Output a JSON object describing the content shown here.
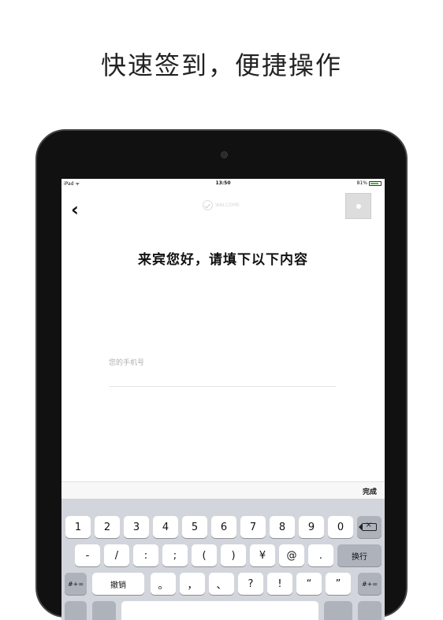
{
  "headline": "快速签到，便捷操作",
  "status_bar": {
    "carrier": "iPad",
    "time": "13:50",
    "battery": "81%",
    "battery_level": 0.81
  },
  "header": {
    "back_label": "‹",
    "logo_text": "WALCOME"
  },
  "form": {
    "title": "来宾您好，请填下以下内容",
    "phone_placeholder": "您的手机号",
    "phone_value": ""
  },
  "accessory": {
    "done_label": "完成"
  },
  "keyboard": {
    "row1": [
      "1",
      "2",
      "3",
      "4",
      "5",
      "6",
      "7",
      "8",
      "9",
      "0"
    ],
    "row2": [
      "-",
      "/",
      ":",
      ";",
      "(",
      ")",
      "¥",
      "@",
      "."
    ],
    "row2_action": "换行",
    "row3_left": "#+=",
    "row3_undo": "撤销",
    "row3": [
      "。",
      "，",
      "、",
      "?",
      "!",
      "“",
      "”"
    ],
    "row3_right": "#+="
  }
}
